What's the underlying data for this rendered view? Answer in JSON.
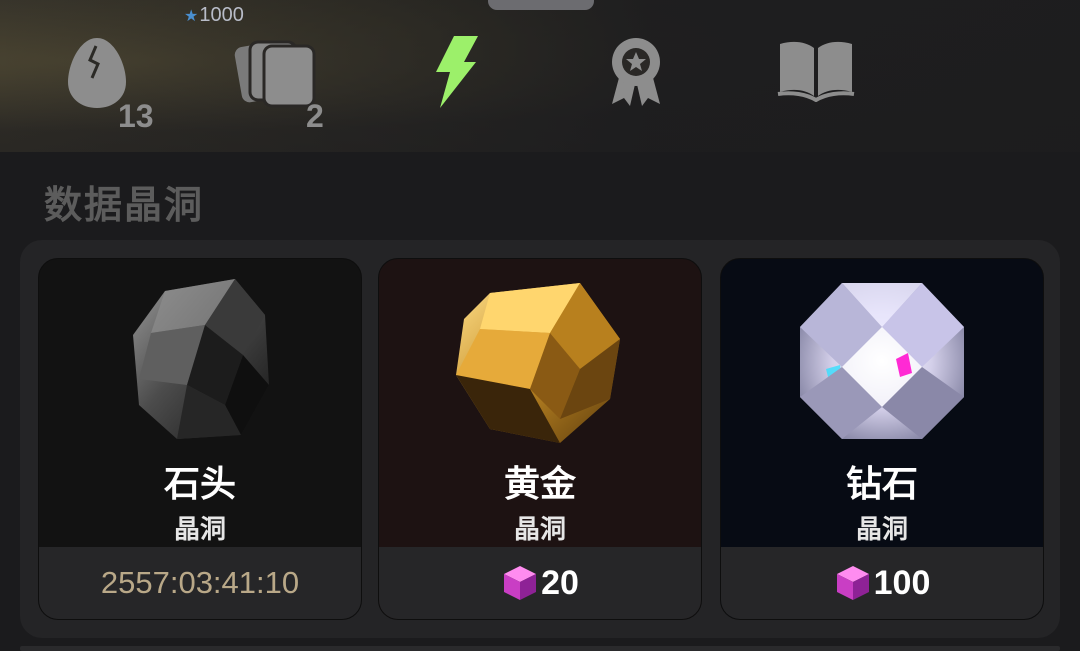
{
  "header": {
    "top_tag": "1000",
    "tabs": [
      {
        "icon": "egg-icon",
        "count": "13",
        "active": false
      },
      {
        "icon": "cards-icon",
        "count": "2",
        "active": false
      },
      {
        "icon": "lightning-icon",
        "count": "",
        "active": true
      },
      {
        "icon": "medal-icon",
        "count": "",
        "active": false
      },
      {
        "icon": "book-icon",
        "count": "",
        "active": false
      }
    ]
  },
  "section": {
    "title": "数据晶洞"
  },
  "cards": [
    {
      "name": "石头",
      "subtitle": "晶洞",
      "footer_text": "2557:03:41:10",
      "footer_type": "timer",
      "gem": "stone"
    },
    {
      "name": "黄金",
      "subtitle": "晶洞",
      "footer_text": "20",
      "footer_type": "price",
      "gem": "gold",
      "currency_icon": "pink-cube-icon"
    },
    {
      "name": "钻石",
      "subtitle": "晶洞",
      "footer_text": "100",
      "footer_type": "price",
      "gem": "diamond",
      "currency_icon": "pink-cube-icon"
    }
  ],
  "colors": {
    "active_tab": "#9cf06a",
    "inactive_tab": "#8d8d8d",
    "timer": "#b9a888",
    "card_stone_bg": "#121212",
    "card_gold_bg": "#1d1212",
    "card_diamond_bg": "#070b14"
  }
}
